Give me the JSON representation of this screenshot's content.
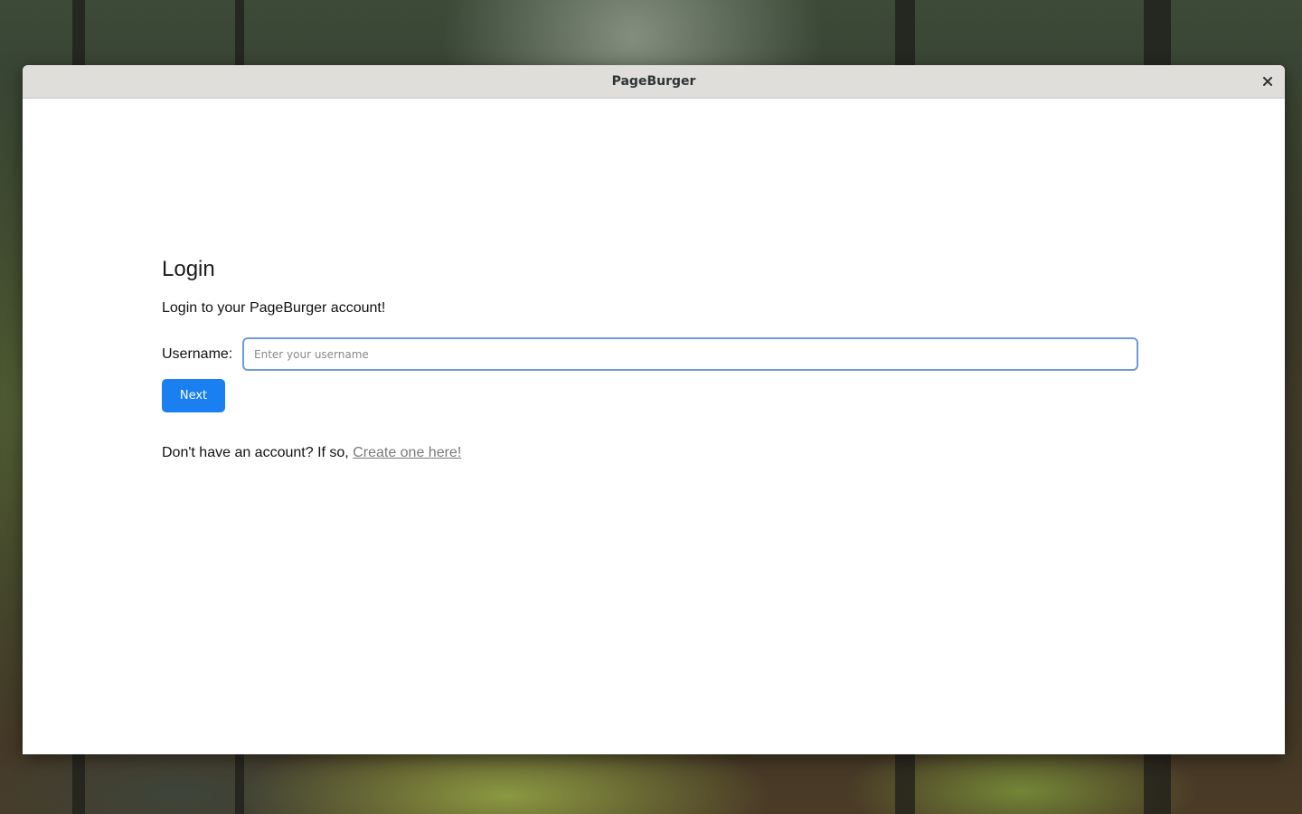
{
  "window": {
    "title": "PageBurger"
  },
  "login": {
    "heading": "Login",
    "subtitle": "Login to your PageBurger account!",
    "username_label": "Username:",
    "username_value": "",
    "username_placeholder": "Enter your username",
    "next_label": "Next",
    "signup_prompt": "Don't have an account? If so, ",
    "signup_link": "Create one here!"
  },
  "icons": {
    "close": "close-icon"
  },
  "colors": {
    "accent": "#1a7ff0",
    "input_focus_border": "#6e9bd6",
    "titlebar": "#e0dedb",
    "link": "#7a7a7a"
  }
}
